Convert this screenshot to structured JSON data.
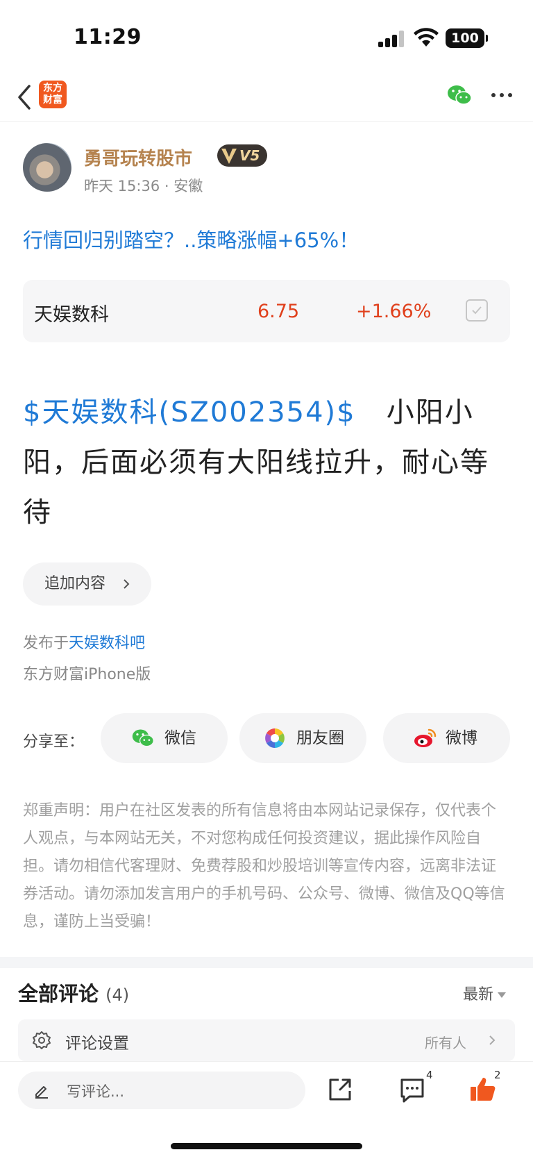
{
  "status_bar": {
    "time": "11:29",
    "battery": "100"
  },
  "nav": {
    "logo_line1": "东方",
    "logo_line2": "财富"
  },
  "author": {
    "name": "勇哥玩转股市",
    "level": "V5",
    "meta": "昨天 15:36 · 安徽"
  },
  "post": {
    "title": "行情回归别踏空？..策略涨幅+65%！",
    "stock_card": {
      "name": "天娱数科",
      "price": "6.75",
      "change": "+1.66%"
    },
    "body_link": "$天娱数科(SZ002354)$",
    "body_text": "小阳小阳，后面必须有大阳线拉升，耐心等待",
    "append_label": "追加内容",
    "posted_in_prefix": "发布于",
    "posted_in_bar": "天娱数科吧",
    "client": "东方财富iPhone版"
  },
  "share": {
    "label": "分享至：",
    "buttons": [
      {
        "icon": "wechat-icon",
        "label": "微信"
      },
      {
        "icon": "moments-icon",
        "label": "朋友圈"
      },
      {
        "icon": "weibo-icon",
        "label": "微博"
      }
    ]
  },
  "disclaimer": "郑重声明：用户在社区发表的所有信息将由本网站记录保存，仅代表个人观点，与本网站无关，不对您构成任何投资建议，据此操作风险自担。请勿相信代客理财、免费荐股和炒股培训等宣传内容，远离非法证券活动。请勿添加发言用户的手机号码、公众号、微博、微信及QQ等信息，谨防上当受骗！",
  "comments": {
    "title": "全部评论",
    "count": "(4)",
    "sort": "最新",
    "settings_label": "评论设置",
    "settings_value": "所有人"
  },
  "bottom_bar": {
    "placeholder": "写评论...",
    "comment_badge": "4",
    "like_badge": "2"
  },
  "colors": {
    "accent_blue": "#1f7ad6",
    "up_red": "#e0401c",
    "brand_orange": "#f0581f"
  }
}
